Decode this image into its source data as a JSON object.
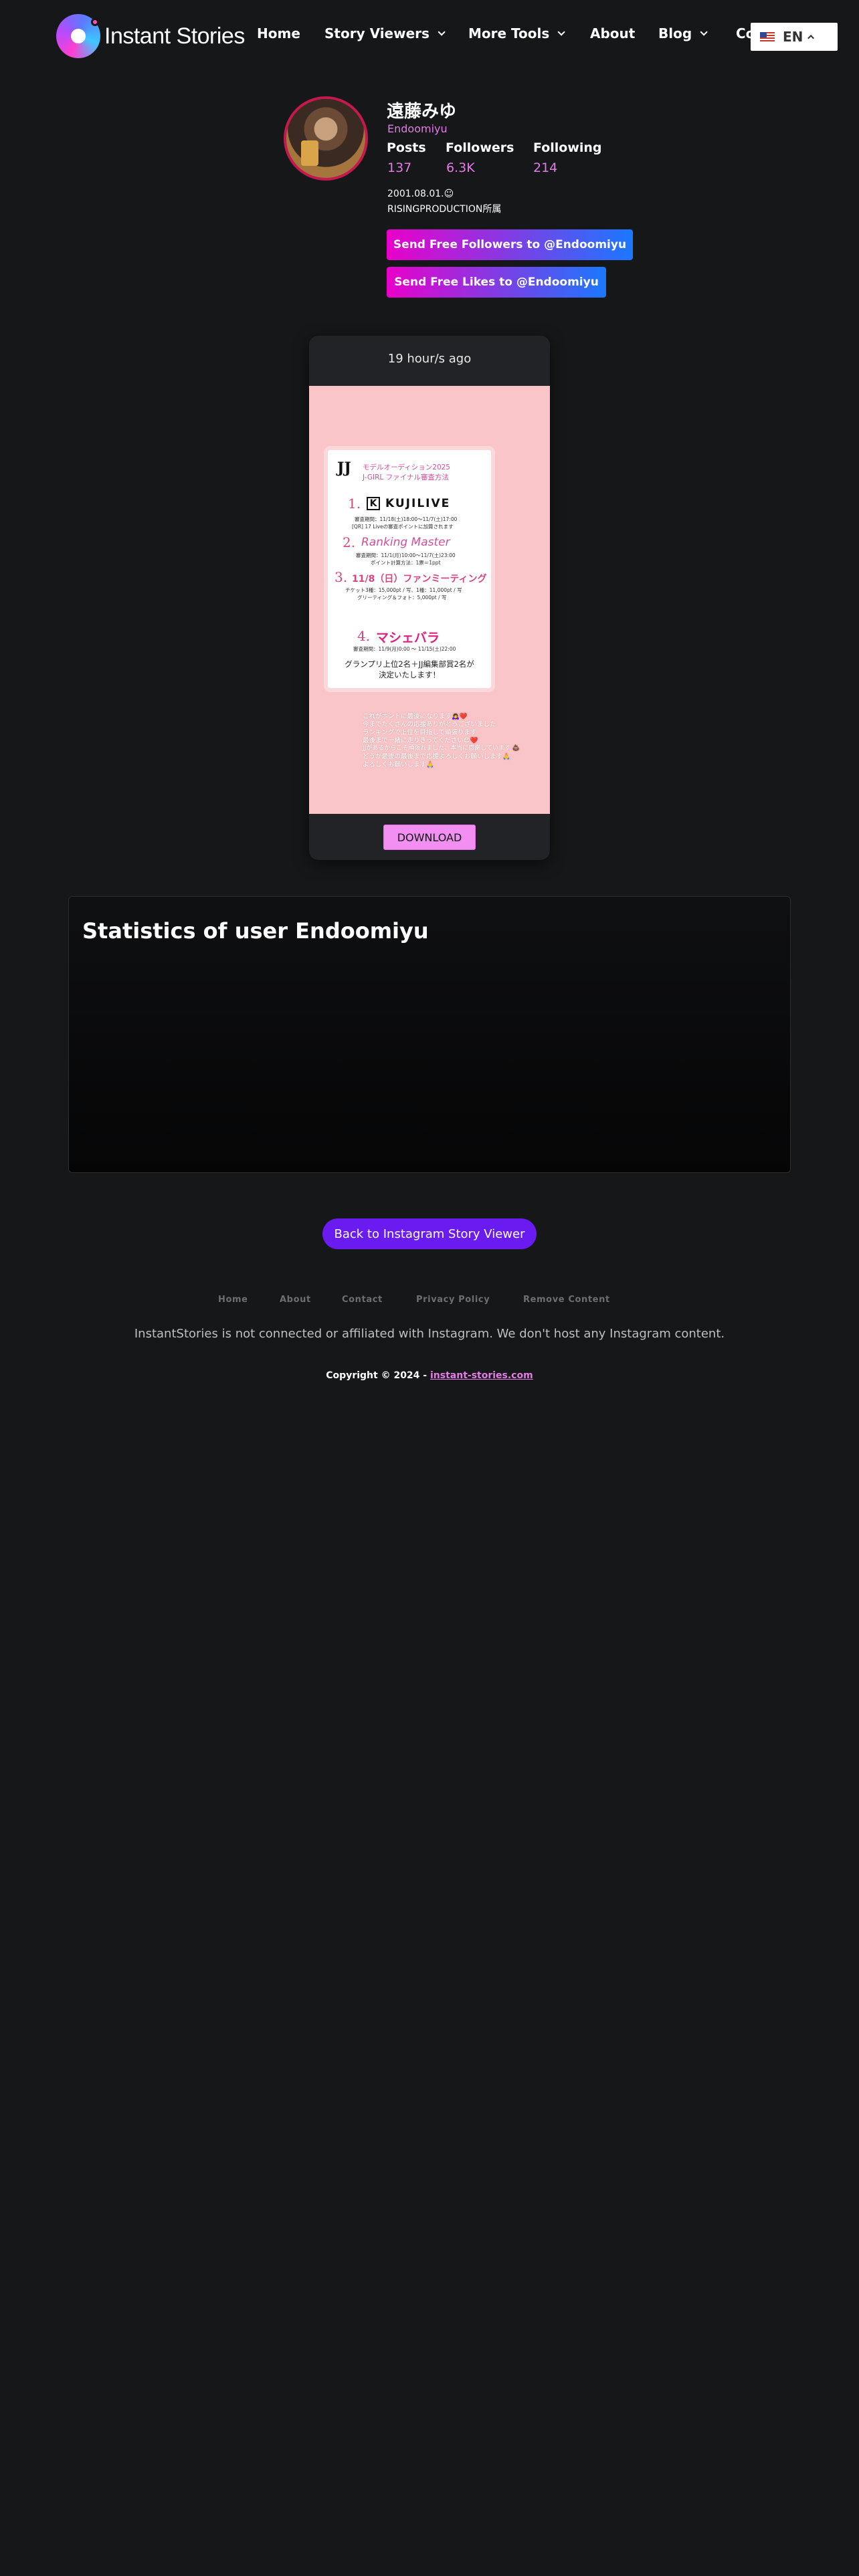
{
  "nav": {
    "logo_text": "Instant Stories",
    "items": [
      {
        "label": "Home"
      },
      {
        "label": "Story Viewers"
      },
      {
        "label": "More Tools"
      },
      {
        "label": "About"
      },
      {
        "label": "Blog"
      },
      {
        "label": "Co"
      }
    ],
    "language": "EN"
  },
  "profile": {
    "name": "遠藤みゆ",
    "handle": "Endoomiyu",
    "stats": [
      {
        "label": "Posts",
        "value": "137"
      },
      {
        "label": "Followers",
        "value": "6.3K"
      },
      {
        "label": "Following",
        "value": "214"
      }
    ],
    "bio_lines": [
      "2001.08.01.☺︎",
      "RISINGPRODUCTION所属"
    ],
    "followers_button": "Send Free Followers to @Endoomiyu",
    "likes_button": "Send Free Likes to @Endoomiyu"
  },
  "story": {
    "time": "19 hour/s ago",
    "flyer": {
      "logo": "JJ",
      "title1": "モデルオーディション2025",
      "title2": "J-GIRL ファイナル審査方法",
      "items": [
        {
          "num": "1.",
          "name": "KUJILIVE",
          "detail1": "審査期間：11/18(土)18:00〜11/7(土)17:00",
          "detail2": "[QR] 17 Liveの審査ポイントに加算されます"
        },
        {
          "num": "2.",
          "name": "Ranking Master",
          "detail1": "審査期間：11/1(月)10:00〜11/7(土)23:00",
          "detail2": "ポイント計算方法：1票＝1ppt"
        },
        {
          "num": "3.",
          "name": "11/8（日）ファンミーティング",
          "detail1": "チケット3種：15,000pt / 写、1種：11,000pt / 写",
          "detail2": "グリーティング＆フォト：5,000pt / 写"
        },
        {
          "num": "4.",
          "name": "マシェバラ",
          "detail1": "審査期間：11/9(月)0:00 〜 11/15(土)22:00",
          "detail2": ""
        }
      ],
      "footer1": "グランプリ上位2名＋JJ編集部賞2名が",
      "footer2": "決定いたします！"
    },
    "caption_lines": [
      "これがホントに最後になります🙇‍♀️❤️",
      "今までたくさんの応援ありがとうございました",
      "ランキングで上位を目指して頑張ります",
      "最後まで一緒に走りきってください😊❤️",
      "JJがあるからこそ頑張れました、本当に感謝しています 💩",
      "どうか最後の最後まで応援よろしくお願いします🙏",
      "よろしくお願いします🙏"
    ],
    "download_label": "DOWNLOAD"
  },
  "statistics": {
    "title": "Statistics of user Endoomiyu"
  },
  "back_button": "Back to Instagram Story Viewer",
  "footer": {
    "links": [
      "Home",
      "About",
      "Contact",
      "Privacy Policy",
      "Remove Content"
    ],
    "disclaimer": "InstantStories is not connected or affiliated with Instagram. We don't host any Instagram content.",
    "copyright_prefix": "Copyright © 2024 - ",
    "copyright_link": "instant-stories.com"
  },
  "colors": {
    "background": "#161719",
    "accent_pink": "#e47be6",
    "button_gradient_start": "#e900c9",
    "button_gradient_end": "#1a78ff",
    "back_button": "#6a1cf0",
    "story_bg": "#f9c5c8"
  }
}
